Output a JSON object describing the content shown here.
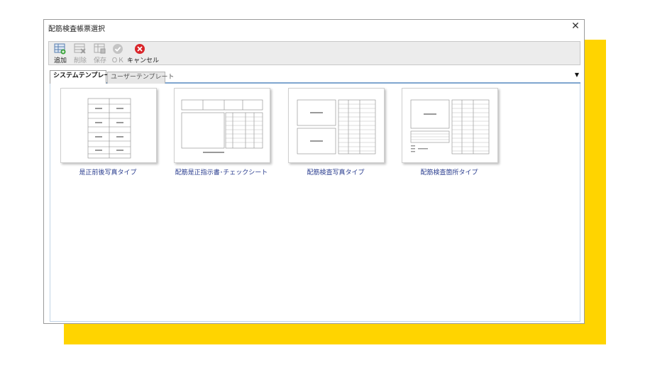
{
  "dialog": {
    "title": "配筋検査帳票選択",
    "close_glyph": "✕"
  },
  "toolbar": {
    "add_label": "追加",
    "delete_label": "削除",
    "save_label": "保存",
    "ok_label": "ＯＫ",
    "cancel_label": "キャンセル"
  },
  "tabs": [
    {
      "label": "システムテンプレート",
      "active": true
    },
    {
      "label": "ユーザーテンプレート",
      "active": false
    }
  ],
  "tabs_dropdown_glyph": "▼",
  "templates": [
    {
      "label": "是正前後写真タイプ",
      "icon": "template-thumbnail"
    },
    {
      "label": "配筋是正指示書･チェックシート",
      "icon": "template-thumbnail"
    },
    {
      "label": "配筋検査写真タイプ",
      "icon": "template-thumbnail"
    },
    {
      "label": "配筋検査箇所タイプ",
      "icon": "template-thumbnail"
    }
  ],
  "colors": {
    "accent_yellow": "#ffd400",
    "tab_underline": "#7fa6cf",
    "label_blue": "#2a3d8f",
    "cancel_red": "#d9252a"
  }
}
